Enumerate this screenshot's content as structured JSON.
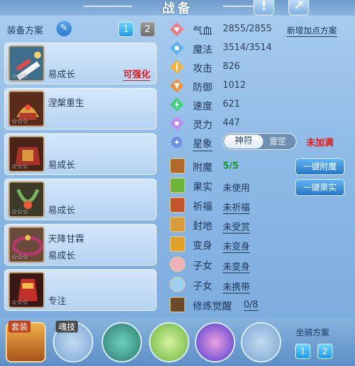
{
  "header": {
    "title": "战备",
    "help_label": "!",
    "share_label": "↗"
  },
  "scheme": {
    "label": "装备方案",
    "tabs": [
      "1",
      "2"
    ],
    "active_tab": "1"
  },
  "equipment": [
    {
      "name": "易成长",
      "action": "可强化",
      "stars": "☆☆☆"
    },
    {
      "name": "涅槃重生",
      "action": "",
      "stars": "☆☆☆"
    },
    {
      "name": "易成长",
      "action": "",
      "stars": "☆☆☆"
    },
    {
      "name": "易成长",
      "action": "",
      "stars": "☆☆☆"
    },
    {
      "name": "天降甘霖",
      "name2": "易成长",
      "action": "",
      "stars": "☆☆☆"
    },
    {
      "name": "专注",
      "action": "",
      "stars": "☆☆☆"
    }
  ],
  "stats": [
    {
      "label": "气血",
      "value": "2855/2855",
      "icon": "heart-icon",
      "color": "#f07a82"
    },
    {
      "label": "魔法",
      "value": "3514/3514",
      "icon": "mana-icon",
      "color": "#58b2f0"
    },
    {
      "label": "攻击",
      "value": "826",
      "icon": "attack-icon",
      "color": "#f5b13a"
    },
    {
      "label": "防御",
      "value": "1012",
      "icon": "defense-icon",
      "color": "#f28f3b"
    },
    {
      "label": "速度",
      "value": "621",
      "icon": "speed-icon",
      "color": "#3fd27a"
    },
    {
      "label": "灵力",
      "value": "447",
      "icon": "spirit-icon",
      "color": "#c28bf0"
    }
  ],
  "add_points_label": "新增加点方案",
  "xingxiang": {
    "label": "星象",
    "option_on": "神符",
    "option_off": "雷罡",
    "status": "未加满"
  },
  "enhancements": [
    {
      "label": "附魔",
      "value": "5/5",
      "style": "green"
    },
    {
      "label": "果实",
      "value": "未使用",
      "style": ""
    },
    {
      "label": "祈福",
      "value": "未祈福",
      "style": "u"
    },
    {
      "label": "封地",
      "value": "未受赏",
      "style": "u"
    },
    {
      "label": "变身",
      "value": "未变身",
      "style": "u"
    },
    {
      "label": "子女",
      "value": "未变身",
      "style": "u"
    },
    {
      "label": "子女",
      "value": "未携带",
      "style": "u"
    },
    {
      "label": "修炼觉醒",
      "value": "0/8",
      "style": "u"
    }
  ],
  "buttons": {
    "enchant": "一键附魔",
    "fruit": "一键果实"
  },
  "bottom": {
    "suit_label": "套装",
    "soul_label": "魂技",
    "mount_label": "坐骑方案",
    "mount_tabs": [
      "1",
      "2"
    ]
  }
}
